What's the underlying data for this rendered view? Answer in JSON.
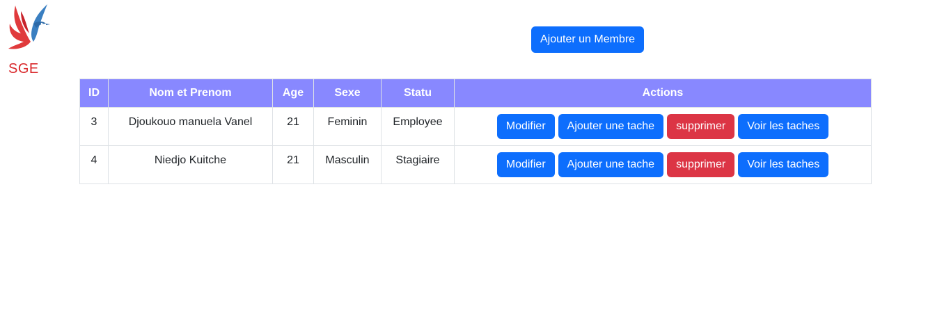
{
  "brand": {
    "logo_icon": "hummingbird-logo-icon",
    "name": "SGE",
    "colors": {
      "red": "#d9292c",
      "blue": "#3a7fc1"
    }
  },
  "toolbar": {
    "add_member_label": "Ajouter un Membre"
  },
  "table": {
    "header_color": "#8888ff",
    "columns": [
      "ID",
      "Nom et Prenom",
      "Age",
      "Sexe",
      "Statu",
      "Actions"
    ],
    "rows": [
      {
        "id": "3",
        "name": "Djoukouo manuela Vanel",
        "age": "21",
        "sexe": "Feminin",
        "statu": "Employee"
      },
      {
        "id": "4",
        "name": "Niedjo Kuitche",
        "age": "21",
        "sexe": "Masculin",
        "statu": "Stagiaire"
      }
    ],
    "actions": {
      "edit_label": "Modifier",
      "add_task_label": "Ajouter une tache",
      "delete_label": "supprimer",
      "view_tasks_label": "Voir les taches"
    }
  },
  "theme": {
    "primary": "#0d6efd",
    "danger": "#dc3545"
  }
}
